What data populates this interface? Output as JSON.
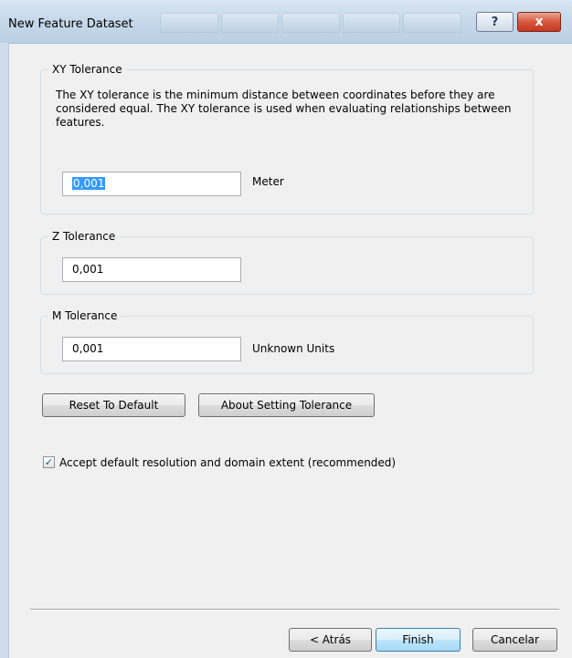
{
  "window": {
    "title": "New Feature Dataset",
    "help_label": "?",
    "close_label": "x"
  },
  "xy_tolerance": {
    "title": "XY Tolerance",
    "description": "The XY tolerance is the minimum distance between coordinates before they are considered equal. The XY tolerance is used when evaluating relationships between features.",
    "value": "0,001",
    "unit": "Meter"
  },
  "z_tolerance": {
    "title": "Z Tolerance",
    "value": "0,001"
  },
  "m_tolerance": {
    "title": "M Tolerance",
    "value": "0,001",
    "unit": "Unknown Units"
  },
  "buttons": {
    "reset": "Reset To Default",
    "about": "About Setting Tolerance",
    "back": "< Atrás",
    "finish": "Finish",
    "cancel": "Cancelar"
  },
  "accept_default": {
    "label": "Accept default resolution and domain extent (recommended)",
    "checked": true,
    "check_glyph": "✓"
  },
  "icons": {
    "help": "help-icon",
    "close": "close-icon",
    "check": "checkmark-icon"
  },
  "colors": {
    "titlebar": "#c7d9ea",
    "close_button": "#d8573f",
    "selection": "#3399ff",
    "primary_button_border": "#3c7fb1"
  }
}
